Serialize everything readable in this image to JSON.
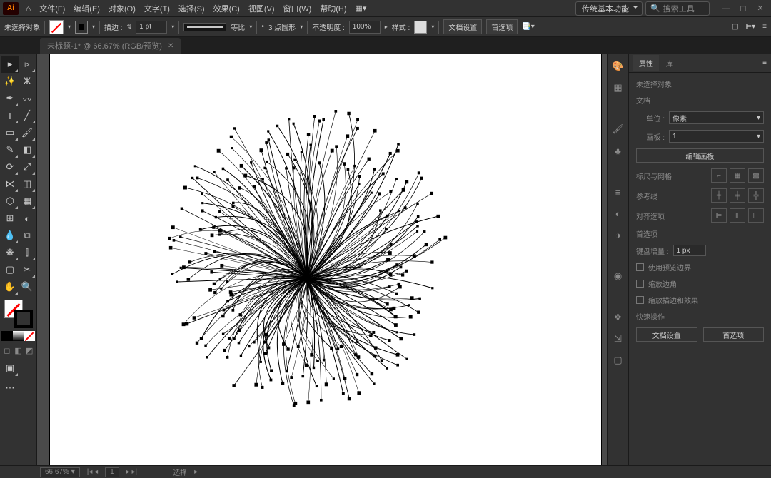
{
  "menubar": {
    "logo": "Ai",
    "items": [
      "文件(F)",
      "编辑(E)",
      "对象(O)",
      "文字(T)",
      "选择(S)",
      "效果(C)",
      "视图(V)",
      "窗口(W)",
      "帮助(H)"
    ],
    "workspace": "传统基本功能",
    "search_placeholder": "搜索工具"
  },
  "optionsbar": {
    "no_selection": "未选择对象",
    "stroke_label": "描边 :",
    "stroke_weight": "1 pt",
    "uniform": "等比",
    "profile_val": "3 点圆形",
    "opacity_label": "不透明度 :",
    "opacity_val": "100%",
    "style_label": "样式 :",
    "doc_setup": "文档设置",
    "prefs": "首选项"
  },
  "doc_tab": {
    "title": "未标题-1* @ 66.67% (RGB/预览)"
  },
  "tools": {
    "fill_none": true,
    "colors": [
      "#000000",
      "#ffffff",
      "none"
    ]
  },
  "properties": {
    "tab_props": "属性",
    "tab_libs": "库",
    "no_sel": "未选择对象",
    "section_doc": "文档",
    "unit_label": "单位 :",
    "unit_val": "像素",
    "artboard_label": "画板 :",
    "artboard_val": "1",
    "edit_artboard": "编辑画板",
    "section_rulers": "标尺与网格",
    "section_guides": "参考线",
    "section_align": "对齐选项",
    "section_prefs": "首选项",
    "key_inc_label": "键盘增量 :",
    "key_inc_val": "1 px",
    "chk_preview": "使用预览边界",
    "chk_scale_corner": "缩放边角",
    "chk_scale_stroke": "缩放描边和效果",
    "quick_actions": "快速操作",
    "btn_doc_setup": "文档设置",
    "btn_prefs": "首选项"
  },
  "statusbar": {
    "zoom": "66.67%",
    "artboard_nav": "1",
    "tool": "选择"
  }
}
